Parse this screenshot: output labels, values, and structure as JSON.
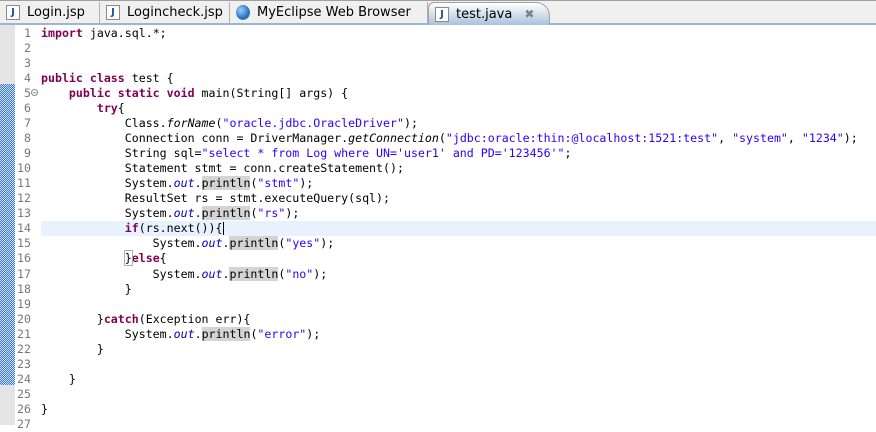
{
  "tabs": [
    {
      "label": "Login.jsp",
      "icon": "jsp-file-icon",
      "active": false
    },
    {
      "label": "Logincheck.jsp",
      "icon": "jsp-file-icon",
      "active": false
    },
    {
      "label": "MyEclipse Web Browser",
      "icon": "globe-icon",
      "active": false
    },
    {
      "label": "test.java",
      "icon": "java-file-icon",
      "active": true,
      "close": "✖"
    }
  ],
  "editor": {
    "current_line": 14,
    "changed_lines_range": [
      5,
      24
    ],
    "lines": [
      [
        [
          "k",
          "import"
        ],
        [
          "p",
          " java.sql.*;"
        ]
      ],
      [],
      [],
      [
        [
          "k",
          "public class"
        ],
        [
          "p",
          " test {"
        ]
      ],
      [
        [
          "p",
          "    "
        ],
        [
          "k",
          "public static void"
        ],
        [
          "p",
          " main(String[] args) {"
        ]
      ],
      [
        [
          "p",
          "        "
        ],
        [
          "k",
          "try"
        ],
        [
          "p",
          "{"
        ]
      ],
      [
        [
          "p",
          "            Class."
        ],
        [
          "m",
          "forName"
        ],
        [
          "p",
          "("
        ],
        [
          "s",
          "\"oracle.jdbc.OracleDriver\""
        ],
        [
          "p",
          ");"
        ]
      ],
      [
        [
          "p",
          "            Connection conn = DriverManager."
        ],
        [
          "m",
          "getConnection"
        ],
        [
          "p",
          "("
        ],
        [
          "s",
          "\"jdbc:oracle:thin:@localhost:1521:test\""
        ],
        [
          "p",
          ", "
        ],
        [
          "s",
          "\"system\""
        ],
        [
          "p",
          ", "
        ],
        [
          "s",
          "\"1234\""
        ],
        [
          "p",
          ");"
        ]
      ],
      [
        [
          "p",
          "            String sql="
        ],
        [
          "s",
          "\"select * from Log where UN='user1' and PD='123456'\""
        ],
        [
          "p",
          ";"
        ]
      ],
      [
        [
          "p",
          "            Statement stmt = conn.createStatement();"
        ]
      ],
      [
        [
          "p",
          "            System."
        ],
        [
          "f",
          "out"
        ],
        [
          "p",
          "."
        ],
        [
          "h",
          "println"
        ],
        [
          "p",
          "("
        ],
        [
          "s",
          "\"stmt\""
        ],
        [
          "p",
          ");"
        ]
      ],
      [
        [
          "p",
          "            ResultSet rs = stmt.executeQuery(sql);"
        ]
      ],
      [
        [
          "p",
          "            System."
        ],
        [
          "f",
          "out"
        ],
        [
          "p",
          "."
        ],
        [
          "h",
          "println"
        ],
        [
          "p",
          "("
        ],
        [
          "s",
          "\"rs\""
        ],
        [
          "p",
          ");"
        ]
      ],
      [
        [
          "p",
          "            "
        ],
        [
          "k",
          "if"
        ],
        [
          "p",
          "(rs.next()){"
        ],
        [
          "c",
          ""
        ]
      ],
      [
        [
          "p",
          "                System."
        ],
        [
          "f",
          "out"
        ],
        [
          "p",
          "."
        ],
        [
          "h",
          "println"
        ],
        [
          "p",
          "("
        ],
        [
          "s",
          "\"yes\""
        ],
        [
          "p",
          ");"
        ]
      ],
      [
        [
          "p",
          "            "
        ],
        [
          "b",
          "}"
        ],
        [
          "k",
          "else"
        ],
        [
          "p",
          "{"
        ]
      ],
      [
        [
          "p",
          "                System."
        ],
        [
          "f",
          "out"
        ],
        [
          "p",
          "."
        ],
        [
          "h",
          "println"
        ],
        [
          "p",
          "("
        ],
        [
          "s",
          "\"no\""
        ],
        [
          "p",
          ");"
        ]
      ],
      [
        [
          "p",
          "            }"
        ]
      ],
      [],
      [
        [
          "p",
          "        }"
        ],
        [
          "k",
          "catch"
        ],
        [
          "p",
          "(Exception err){"
        ]
      ],
      [
        [
          "p",
          "            System."
        ],
        [
          "f",
          "out"
        ],
        [
          "p",
          "."
        ],
        [
          "h",
          "println"
        ],
        [
          "p",
          "("
        ],
        [
          "s",
          "\"error\""
        ],
        [
          "p",
          ");"
        ]
      ],
      [
        [
          "p",
          "        }"
        ]
      ],
      [],
      [
        [
          "p",
          "    }"
        ]
      ],
      [],
      [
        [
          "p",
          "}"
        ]
      ],
      []
    ]
  }
}
